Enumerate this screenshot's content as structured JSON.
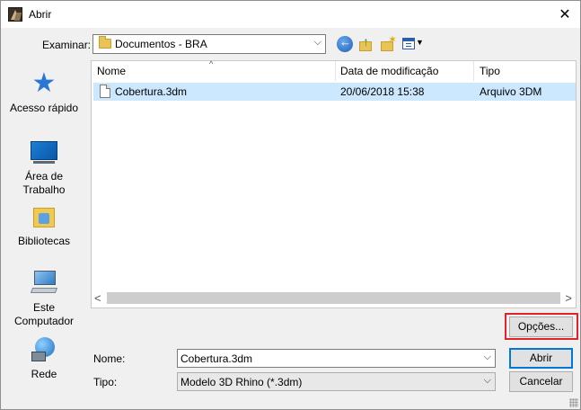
{
  "window": {
    "title": "Abrir",
    "close_glyph": "✕"
  },
  "toolbar": {
    "look_in_label": "Examinar:",
    "look_in_value": "Documentos - BRA",
    "dropdown_glyph": "⌵",
    "icons": [
      "back-icon",
      "up-folder-icon",
      "new-folder-icon",
      "view-menu-icon"
    ]
  },
  "places": [
    {
      "label": "Acesso rápido",
      "icon": "star-icon"
    },
    {
      "label": "Área de Trabalho",
      "icon": "desktop-icon"
    },
    {
      "label": "Bibliotecas",
      "icon": "libraries-icon"
    },
    {
      "label": "Este Computador",
      "icon": "computer-icon"
    },
    {
      "label": "Rede",
      "icon": "network-icon"
    }
  ],
  "file_list": {
    "columns": [
      "Nome",
      "Data de modificação",
      "Tipo"
    ],
    "sort_indicator": "^",
    "rows": [
      {
        "name": "Cobertura.3dm",
        "modified": "20/06/2018 15:38",
        "type": "Arquivo 3DM",
        "selected": true
      }
    ],
    "scroll_left": "<",
    "scroll_right": ">"
  },
  "form": {
    "name_label": "Nome:",
    "name_value": "Cobertura.3dm",
    "type_label": "Tipo:",
    "type_value": "Modelo 3D Rhino (*.3dm)"
  },
  "buttons": {
    "options": "Opções...",
    "open": "Abrir",
    "cancel": "Cancelar"
  },
  "colors": {
    "selection": "#cce8ff",
    "highlight_frame": "#e0242a",
    "default_button_border": "#0078d7"
  }
}
